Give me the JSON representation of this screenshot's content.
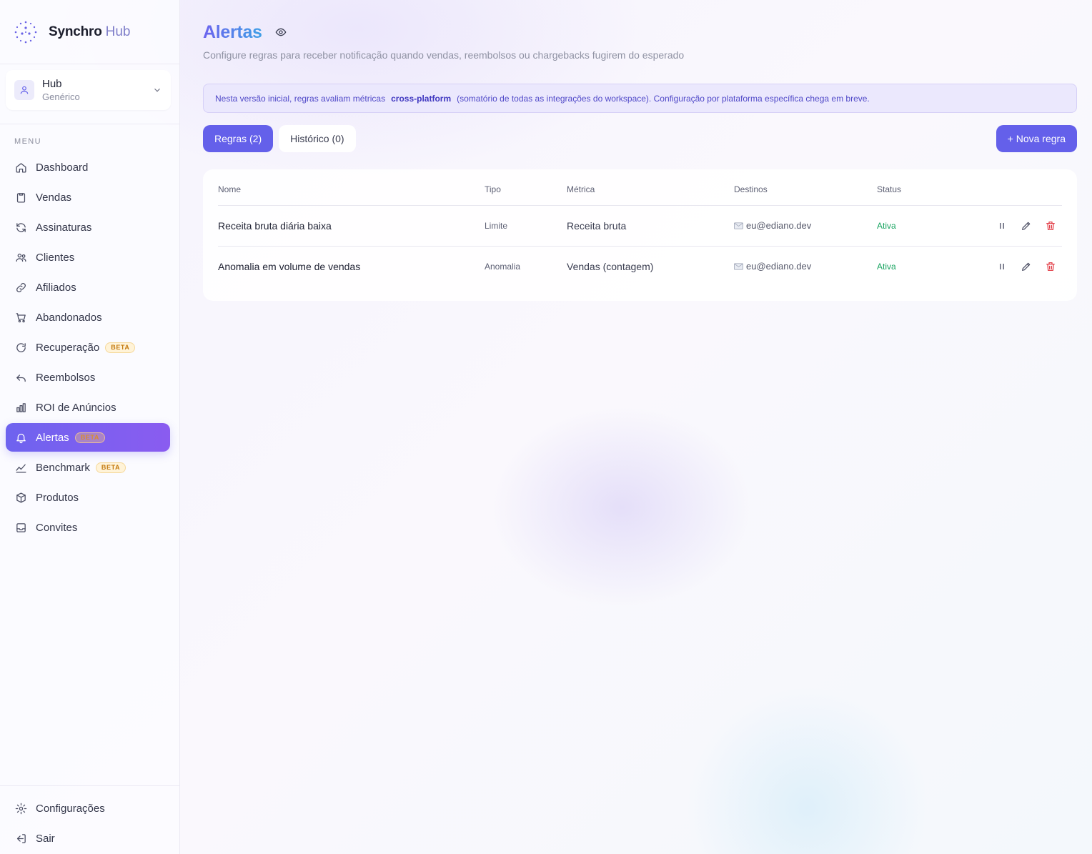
{
  "brand": {
    "name": "Synchro",
    "sub": "Hub"
  },
  "workspace": {
    "name": "Hub",
    "type": "Genérico"
  },
  "menu_label": "MENU",
  "nav": [
    {
      "label": "Dashboard",
      "icon": "home-icon"
    },
    {
      "label": "Vendas",
      "icon": "clipboard-icon"
    },
    {
      "label": "Assinaturas",
      "icon": "refresh-icon"
    },
    {
      "label": "Clientes",
      "icon": "users-icon"
    },
    {
      "label": "Afiliados",
      "icon": "link-icon"
    },
    {
      "label": "Abandonados",
      "icon": "cart-icon"
    },
    {
      "label": "Recuperação",
      "icon": "rotate-icon",
      "badge": "BETA"
    },
    {
      "label": "Reembolsos",
      "icon": "undo-icon"
    },
    {
      "label": "ROI de Anúncios",
      "icon": "bar-chart-icon"
    },
    {
      "label": "Alertas",
      "icon": "bell-icon",
      "badge": "BETA",
      "active": true
    },
    {
      "label": "Benchmark",
      "icon": "trend-icon",
      "badge": "BETA"
    },
    {
      "label": "Produtos",
      "icon": "box-icon"
    },
    {
      "label": "Convites",
      "icon": "inbox-icon"
    }
  ],
  "bottom_nav": [
    {
      "label": "Configurações",
      "icon": "gear-icon"
    },
    {
      "label": "Sair",
      "icon": "logout-icon"
    }
  ],
  "page": {
    "title": "Alertas",
    "subtitle": "Configure regras para receber notificação quando vendas, reembolsos ou chargebacks fugirem do esperado",
    "info_prefix": "Nesta versão inicial, regras avaliam métricas",
    "info_bold": "cross-platform",
    "info_suffix": "(somatório de todas as integrações do workspace). Configuração por plataforma específica chega em breve."
  },
  "tabs": {
    "rules": "Regras (2)",
    "history": "Histórico (0)"
  },
  "new_rule_label": "+ Nova regra",
  "table": {
    "headers": [
      "Nome",
      "Tipo",
      "Métrica",
      "Destinos",
      "Status"
    ],
    "rows": [
      {
        "nome": "Receita bruta diária baixa",
        "tipo": "Limite",
        "metrica": "Receita bruta",
        "destino": "eu@ediano.dev",
        "status": "Ativa"
      },
      {
        "nome": "Anomalia em volume de vendas",
        "tipo": "Anomalia",
        "metrica": "Vendas (contagem)",
        "destino": "eu@ediano.dev",
        "status": "Ativa"
      }
    ]
  },
  "colors": {
    "accent": "#6460ea",
    "active_status": "#1ba562",
    "delete": "#e0303a",
    "badge": "#c47a10"
  }
}
